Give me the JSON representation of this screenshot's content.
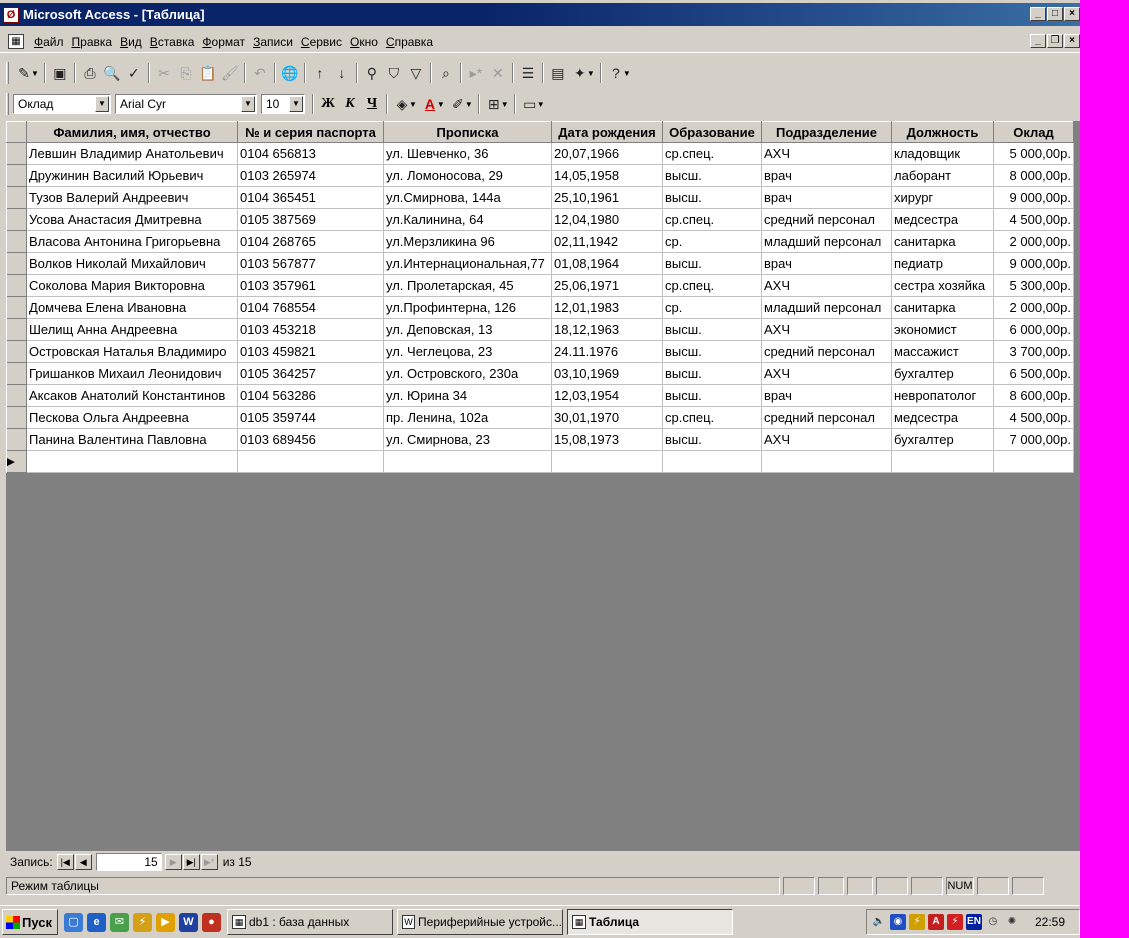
{
  "window": {
    "title": "Microsoft Access - [Таблица]",
    "app_icon_letter": "Ø"
  },
  "menu": {
    "items": [
      "Файл",
      "Правка",
      "Вид",
      "Вставка",
      "Формат",
      "Записи",
      "Сервис",
      "Окно",
      "Справка"
    ]
  },
  "format_toolbar": {
    "field_combo": "Оклад",
    "font_combo": "Arial Cyr",
    "size_combo": "10",
    "bold_label": "Ж",
    "italic_label": "К",
    "underline_label": "Ч"
  },
  "table": {
    "columns": [
      "Фамилия, имя, отчество",
      "№ и серия паспорта",
      "Прописка",
      "Дата рождения",
      "Образование",
      "Подразделение",
      "Должность",
      "Оклад"
    ],
    "rows": [
      [
        "Левшин Владимир Анатольевич",
        "0104 656813",
        "ул. Шевченко, 36",
        "20,07,1966",
        "ср.спец.",
        "АХЧ",
        "кладовщик",
        "5 000,00р."
      ],
      [
        "Дружинин Василий Юрьевич",
        "0103 265974",
        "ул. Ломоносова, 29",
        "14,05,1958",
        "высш.",
        "врач",
        "лаборант",
        "8 000,00р."
      ],
      [
        "Тузов Валерий Андреевич",
        "0104 365451",
        "ул.Смирнова, 144а",
        "25,10,1961",
        "высш.",
        "врач",
        "хирург",
        "9 000,00р."
      ],
      [
        "Усова Анастасия Дмитревна",
        "0105 387569",
        "ул.Калинина, 64",
        "12,04,1980",
        "ср.спец.",
        "средний персонал",
        "медсестра",
        "4 500,00р."
      ],
      [
        "Власова Антонина Григорьевна",
        "0104 268765",
        "ул.Мерзликина 96",
        "02,11,1942",
        "ср.",
        "младший персонал",
        "санитарка",
        "2 000,00р."
      ],
      [
        "Волков Николай Михайлович",
        "0103 567877",
        "ул.Интернациональная,77",
        "01,08,1964",
        "высш.",
        "врач",
        "педиатр",
        "9 000,00р."
      ],
      [
        "Соколова Мария Викторовна",
        "0103 357961",
        "ул. Пролетарская, 45",
        "25,06,1971",
        "ср.спец.",
        "АХЧ",
        "сестра хозяйка",
        "5 300,00р."
      ],
      [
        "Домчева Елена Ивановна",
        "0104 768554",
        "ул.Профинтерна, 126",
        "12,01,1983",
        "ср.",
        "младший персонал",
        "санитарка",
        "2 000,00р."
      ],
      [
        "Шелищ Анна Андреевна",
        "0103 453218",
        "ул. Деповская, 13",
        "18,12,1963",
        "высш.",
        "АХЧ",
        "экономист",
        "6 000,00р."
      ],
      [
        "Островская Наталья Владимиро",
        "0103 459821",
        "ул. Чеглецова, 23",
        "24.11.1976",
        "высш.",
        "средний персонал",
        "массажист",
        "3 700,00р."
      ],
      [
        "Гришанков Михаил Леонидович",
        "0105 364257",
        "ул. Островского, 230а",
        "03,10,1969",
        "высш.",
        "АХЧ",
        "бухгалтер",
        "6 500,00р."
      ],
      [
        "Аксаков Анатолий Константинов",
        "0104 563286",
        "ул. Юрина 34",
        "12,03,1954",
        "высш.",
        "врач",
        "невропатолог",
        "8 600,00р."
      ],
      [
        "Пескова Ольга Андреевна",
        "0105 359744",
        "пр. Ленина, 102а",
        "30,01,1970",
        "ср.спец.",
        "средний персонал",
        "медсестра",
        "4 500,00р."
      ],
      [
        "Панина Валентина Павловна",
        "0103 689456",
        "ул. Смирнова, 23",
        "15,08,1973",
        "высш.",
        "АХЧ",
        "бухгалтер",
        "7 000,00р."
      ]
    ],
    "new_row_marker": "▶"
  },
  "navigator": {
    "label": "Запись:",
    "current": "15",
    "of_label": "из 15"
  },
  "status": {
    "mode": "Режим таблицы",
    "num": "NUM"
  },
  "taskbar": {
    "start_label": "Пуск",
    "tasks": [
      "db1 : база данных",
      "Периферийные устройс...",
      "Таблица"
    ],
    "clock": "22:59",
    "lang": "EN"
  }
}
